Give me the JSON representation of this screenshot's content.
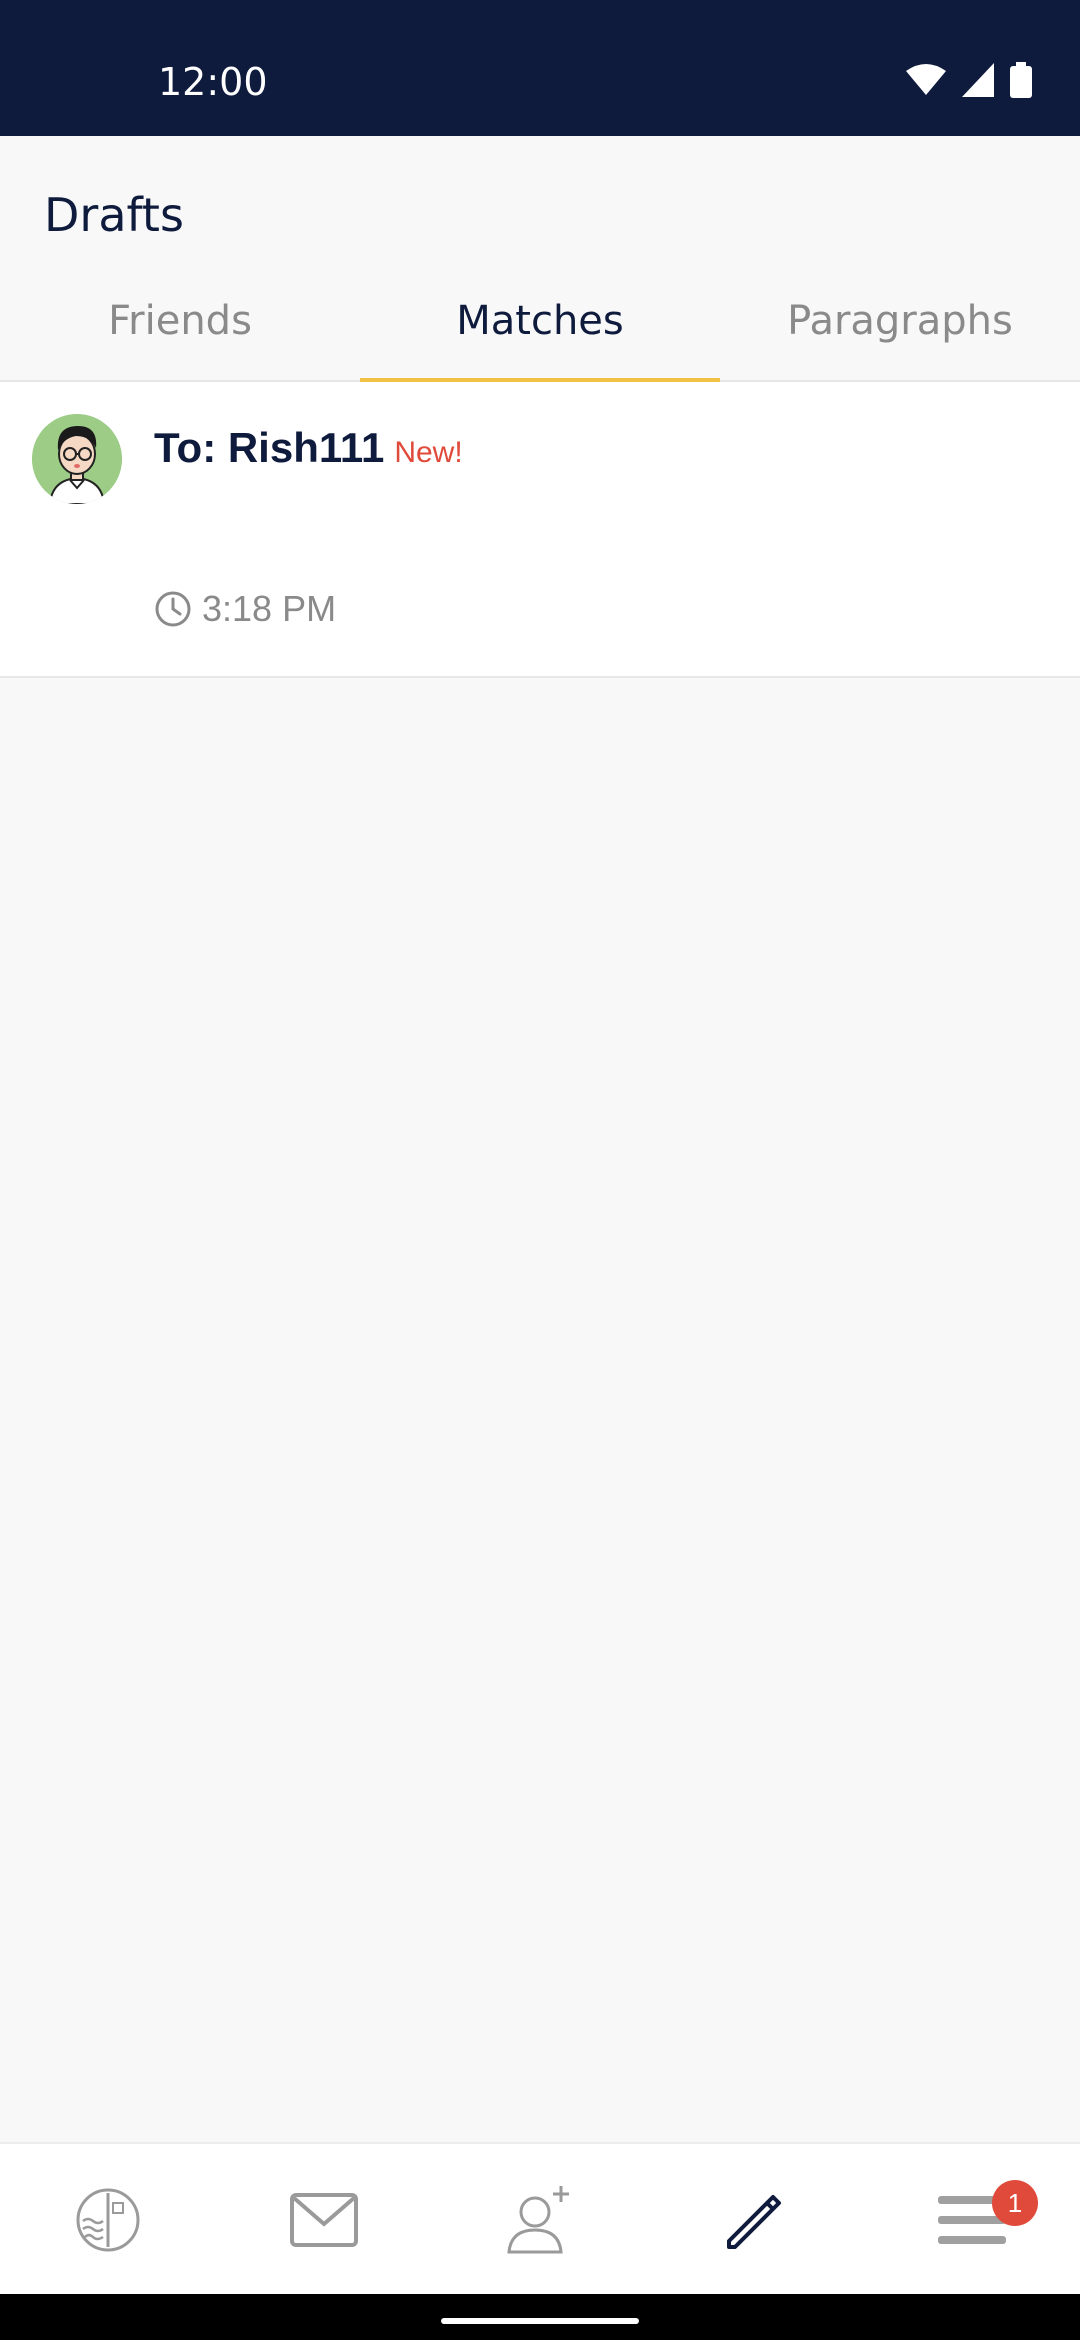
{
  "status_bar": {
    "time": "12:00"
  },
  "header": {
    "title": "Drafts"
  },
  "tabs": [
    {
      "label": "Friends",
      "active": false
    },
    {
      "label": "Matches",
      "active": true
    },
    {
      "label": "Paragraphs",
      "active": false
    }
  ],
  "drafts": [
    {
      "to": "To: Rish111",
      "badge": "New!",
      "time": "3:18 PM"
    }
  ],
  "bottom_nav": {
    "items": [
      "stamp-icon",
      "mail-icon",
      "add-friend-icon",
      "pencil-icon",
      "menu-icon"
    ],
    "menu_badge": "1"
  },
  "colors": {
    "accent": "#f3c244",
    "navy": "#0e1b3d",
    "badge": "#e04a3a"
  }
}
